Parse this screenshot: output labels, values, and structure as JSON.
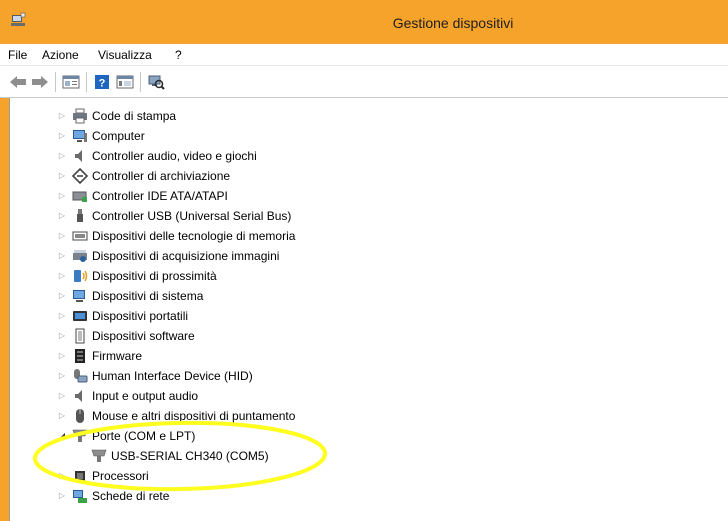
{
  "window": {
    "title": "Gestione dispositivi",
    "accent_color": "#f6a32c"
  },
  "menu": {
    "items": [
      "File",
      "Azione",
      "Visualizza",
      "?"
    ]
  },
  "toolbar": {
    "buttons": [
      "back-arrow-icon",
      "forward-arrow-icon",
      "properties-icon",
      "help-icon",
      "view-icon",
      "scan-hardware-icon"
    ]
  },
  "tree": {
    "items": [
      {
        "label": "Code di stampa",
        "icon": "print-queue-icon",
        "expanded": false,
        "level": 0
      },
      {
        "label": "Computer",
        "icon": "computer-icon",
        "expanded": false,
        "level": 0
      },
      {
        "label": "Controller audio, video e giochi",
        "icon": "speaker-icon",
        "expanded": false,
        "level": 0
      },
      {
        "label": "Controller di archiviazione",
        "icon": "storage-controller-icon",
        "expanded": false,
        "level": 0
      },
      {
        "label": "Controller IDE ATA/ATAPI",
        "icon": "ide-controller-icon",
        "expanded": false,
        "level": 0
      },
      {
        "label": "Controller USB (Universal Serial Bus)",
        "icon": "usb-icon",
        "expanded": false,
        "level": 0
      },
      {
        "label": "Dispositivi delle tecnologie di memoria",
        "icon": "memory-device-icon",
        "expanded": false,
        "level": 0
      },
      {
        "label": "Dispositivi di acquisizione immagini",
        "icon": "scanner-icon",
        "expanded": false,
        "level": 0
      },
      {
        "label": "Dispositivi di prossimità",
        "icon": "proximity-icon",
        "expanded": false,
        "level": 0
      },
      {
        "label": "Dispositivi di sistema",
        "icon": "system-device-icon",
        "expanded": false,
        "level": 0
      },
      {
        "label": "Dispositivi portatili",
        "icon": "portable-device-icon",
        "expanded": false,
        "level": 0
      },
      {
        "label": "Dispositivi software",
        "icon": "software-device-icon",
        "expanded": false,
        "level": 0
      },
      {
        "label": "Firmware",
        "icon": "firmware-icon",
        "expanded": false,
        "level": 0
      },
      {
        "label": "Human Interface Device (HID)",
        "icon": "hid-icon",
        "expanded": false,
        "level": 0
      },
      {
        "label": "Input e output audio",
        "icon": "audio-io-icon",
        "expanded": false,
        "level": 0
      },
      {
        "label": "Mouse e altri dispositivi di puntamento",
        "icon": "mouse-icon",
        "expanded": false,
        "level": 0
      },
      {
        "label": "Porte (COM e LPT)",
        "icon": "port-icon",
        "expanded": true,
        "level": 0
      },
      {
        "label": "USB-SERIAL CH340 (COM5)",
        "icon": "port-icon",
        "expanded": null,
        "level": 1
      },
      {
        "label": "Processori",
        "icon": "processor-icon",
        "expanded": false,
        "level": 0
      },
      {
        "label": "Schede di rete",
        "icon": "network-adapter-icon",
        "expanded": false,
        "level": 0
      }
    ]
  },
  "annotation": {
    "shape": "ellipse",
    "color": "#ffff1f"
  }
}
